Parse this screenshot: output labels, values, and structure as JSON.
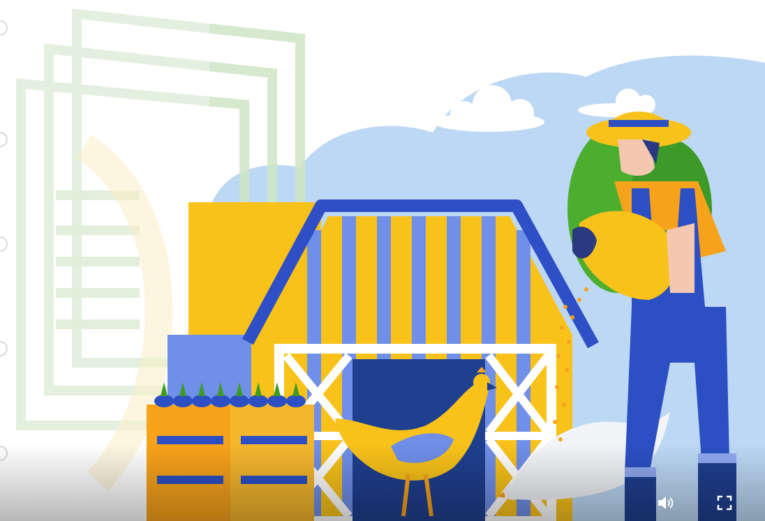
{
  "player": {
    "controls": {
      "volume_icon": "speaker-volume-icon",
      "fullscreen_icon": "fullscreen-expand-icon"
    }
  },
  "scene": {
    "description_icons": [
      "watermark-document-icon",
      "barn",
      "farmer",
      "chicken",
      "crates",
      "clouds"
    ]
  },
  "colors": {
    "sky": "#bcd8f4",
    "barn_yellow": "#f8c21a",
    "barn_blue": "#2f4fc6",
    "barn_light_blue": "#6f8fe8",
    "door_dark": "#1f3f8f",
    "farmer_blue": "#2c4fc4",
    "farmer_orange": "#f7a21b",
    "bush_green": "#4cae2f",
    "watermark_green": "#cfe5c6",
    "control_white": "#ffffff"
  }
}
